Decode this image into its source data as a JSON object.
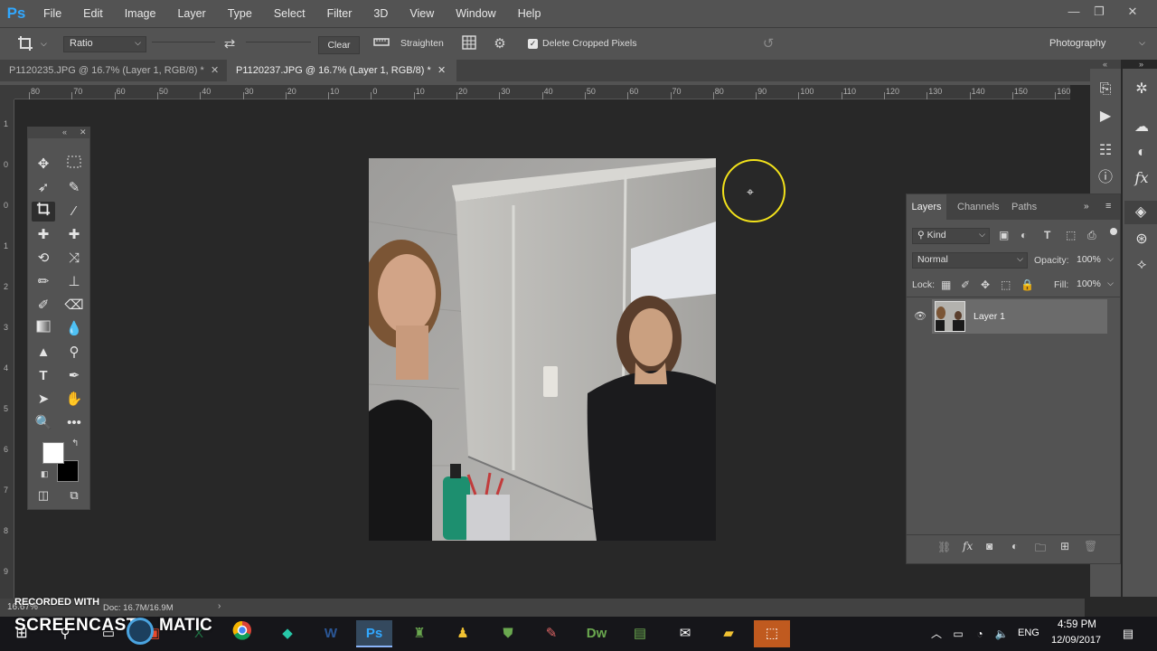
{
  "app": {
    "logo": "Ps"
  },
  "menu": [
    "File",
    "Edit",
    "Image",
    "Layer",
    "Type",
    "Select",
    "Filter",
    "3D",
    "View",
    "Window",
    "Help"
  ],
  "window_controls": {
    "minimize": "—",
    "restore": "❐",
    "close": "✕"
  },
  "options": {
    "ratio_label": "Ratio",
    "clear_label": "Clear",
    "straighten_label": "Straighten",
    "delete_cropped_label": "Delete Cropped Pixels",
    "delete_cropped_checked": true,
    "workspace": "Photography"
  },
  "tabs": [
    {
      "label": "P1120235.JPG @ 16.7% (Layer 1, RGB/8) *",
      "active": false
    },
    {
      "label": "P1120237.JPG @ 16.7% (Layer 1, RGB/8) *",
      "active": true
    }
  ],
  "ruler": {
    "h_labels": [
      "80",
      "70",
      "60",
      "50",
      "40",
      "30",
      "20",
      "10",
      "0",
      "10",
      "20",
      "30",
      "40",
      "50",
      "60",
      "70",
      "80",
      "90",
      "100",
      "110",
      "120",
      "130",
      "140",
      "150",
      "160"
    ],
    "v_labels": [
      "1",
      "0",
      "0",
      "1",
      "2",
      "3",
      "4",
      "5",
      "6",
      "7",
      "8",
      "9"
    ]
  },
  "layers_panel": {
    "tabs": [
      "Layers",
      "Channels",
      "Paths"
    ],
    "filter_kind": "Kind",
    "blend_mode": "Normal",
    "opacity_label": "Opacity:",
    "opacity_value": "100%",
    "lock_label": "Lock:",
    "fill_label": "Fill:",
    "fill_value": "100%",
    "layers": [
      {
        "name": "Layer 1",
        "visible": true
      }
    ]
  },
  "status": {
    "doc": "Doc: 16.7M/16.9M",
    "zoom": "16.67%"
  },
  "watermark": {
    "line1": "RECORDED WITH",
    "line2": "SCREENCAST",
    "line3": "MATIC"
  },
  "taskbar": {
    "lang": "ENG",
    "time": "4:59 PM",
    "date": "12/09/2017"
  }
}
